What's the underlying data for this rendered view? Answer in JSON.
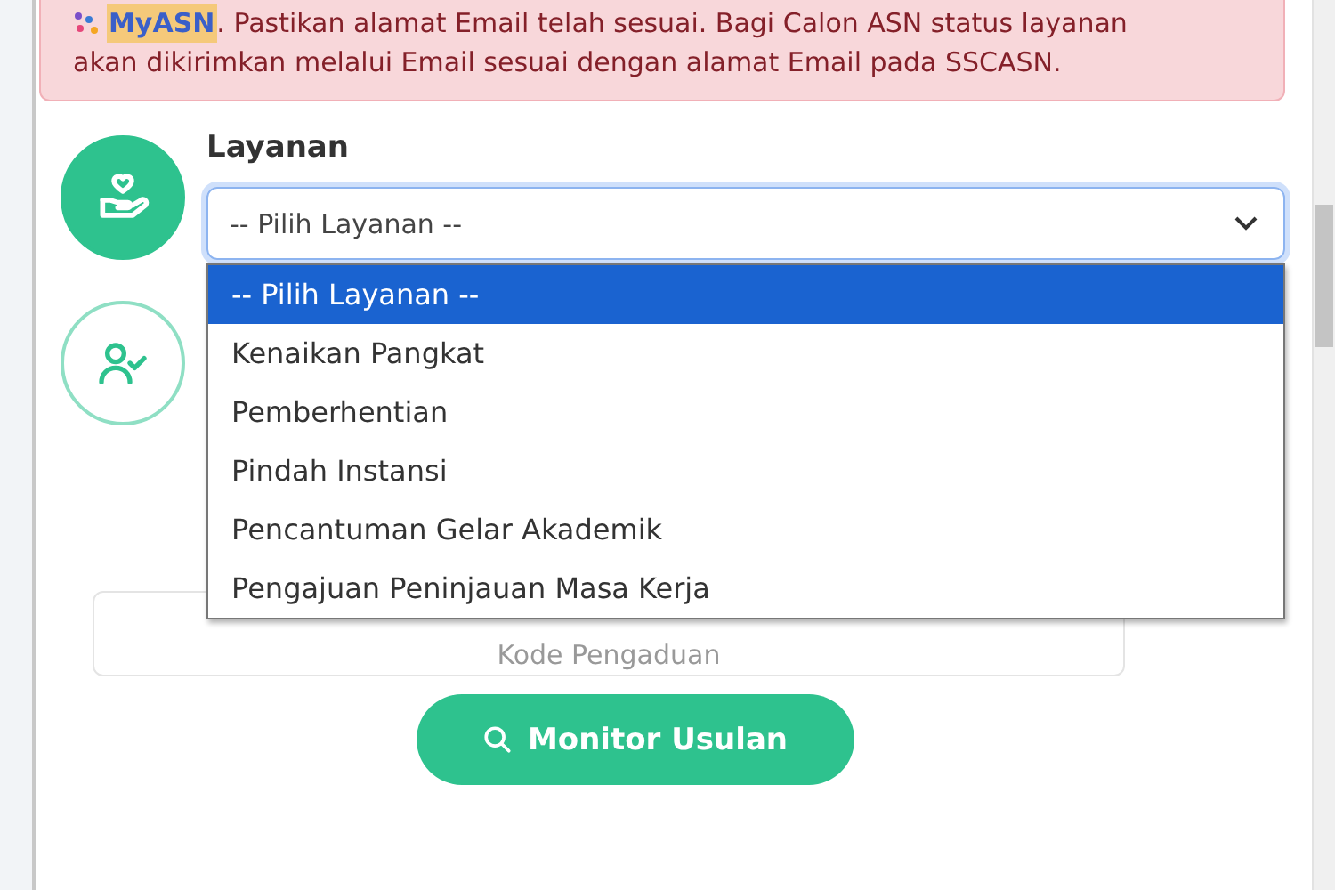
{
  "alert": {
    "brand": "MyASN",
    "line_1": ". Pastikan alamat Email telah sesuai. Bagi Calon ASN status layanan",
    "line_2": "akan dikirimkan melalui Email sesuai dengan alamat Email pada SSCASN."
  },
  "steps": [
    {
      "kind": "service",
      "active": true
    },
    {
      "kind": "person",
      "active": false
    }
  ],
  "layanan": {
    "label": "Layanan",
    "value": "-- Pilih Layanan --",
    "expanded": true,
    "options": [
      {
        "label": "-- Pilih Layanan --",
        "selected": true
      },
      {
        "label": "Kenaikan Pangkat",
        "selected": false
      },
      {
        "label": "Pemberhentian",
        "selected": false
      },
      {
        "label": "Pindah Instansi",
        "selected": false
      },
      {
        "label": "Pencantuman Gelar Akademik",
        "selected": false
      },
      {
        "label": "Pengajuan Peninjauan Masa Kerja",
        "selected": false
      }
    ]
  },
  "kode": {
    "placeholder": "Kode Pengaduan"
  },
  "button": {
    "label": "Monitor Usulan"
  }
}
